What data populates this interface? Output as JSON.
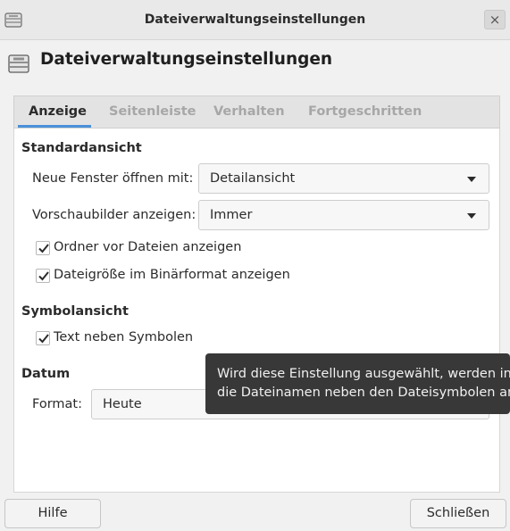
{
  "window": {
    "title": "Dateiverwaltungseinstellungen",
    "close_symbol": "×",
    "icon": "drawer-icon"
  },
  "header": {
    "title": "Dateiverwaltungseinstellungen",
    "icon": "drawer-icon"
  },
  "tabs": [
    {
      "label": "Anzeige",
      "active": true
    },
    {
      "label": "Seitenleiste",
      "active": false
    },
    {
      "label": "Verhalten",
      "active": false
    },
    {
      "label": "Fortgeschritten",
      "active": false
    }
  ],
  "standardansicht": {
    "heading": "Standardansicht",
    "new_window_label": "Neue Fenster öffnen mit:",
    "new_window_value": "Detailansicht",
    "thumbnails_label": "Vorschaubilder anzeigen:",
    "thumbnails_value": "Immer",
    "folders_first_label": "Ordner vor Dateien anzeigen",
    "folders_first_checked": true,
    "binary_size_label": "Dateigröße im Binärformat anzeigen",
    "binary_size_checked": true
  },
  "symbolansicht": {
    "heading": "Symbolansicht",
    "text_beside_label": "Text neben Symbolen",
    "text_beside_checked": true
  },
  "datum": {
    "heading": "Datum",
    "format_label": "Format:",
    "format_value": "Heute"
  },
  "tooltip": {
    "line1": "Wird diese Einstellung ausgewählt, werden in de",
    "line2": "die Dateinamen neben den Dateisymbolen ange"
  },
  "footer": {
    "help_label": "Hilfe",
    "close_label": "Schließen"
  },
  "colors": {
    "accent": "#4a90d9",
    "tooltip_bg": "#383838"
  }
}
